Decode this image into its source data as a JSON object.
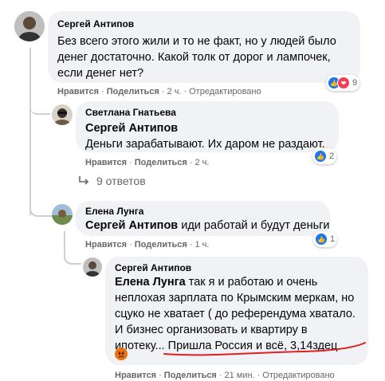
{
  "comments": [
    {
      "author": "Сергей Антипов",
      "text": "Без всего этого жили и то не факт, но у людей было денег достаточно. Какой толк от дорог и лампочек, если денег нет?",
      "like": "Нравится",
      "reply": "Поделиться",
      "time": "2 ч.",
      "edited": "Отредактировано",
      "reactions_count": "9"
    },
    {
      "author": "Светлана Гнатьева",
      "mention": "Сергей Антипов",
      "text": "Деньги зарабатывают. Их даром не раздают.",
      "like": "Нравится",
      "reply": "Поделиться",
      "time": "2 ч.",
      "reactions_count": "2"
    },
    {
      "author": "Елена Лунга",
      "mention": "Сергей Антипов",
      "text": " иди работай и будут деньги",
      "like": "Нравится",
      "reply": "Поделиться",
      "time": "1 ч.",
      "reactions_count": "1"
    },
    {
      "author": "Сергей Антипов",
      "mention": "Елена Лунга",
      "text": " так я и работаю и очень неплохая зарплата по Крымским меркам, но сцуко не хватает ( до референдума хватало. И бизнес организовать и квартиру в ипотеку... Пришла Россия и всё, 3,14здец",
      "like": "Нравится",
      "reply": "Поделиться",
      "time": "21 мин.",
      "edited": "Отредактировано"
    }
  ],
  "replies_link": "9 ответов",
  "dot": "·",
  "colors": {
    "like": "#1877f2",
    "love": "#f33e58",
    "angry": "#e9710f",
    "underline": "#e02020"
  }
}
